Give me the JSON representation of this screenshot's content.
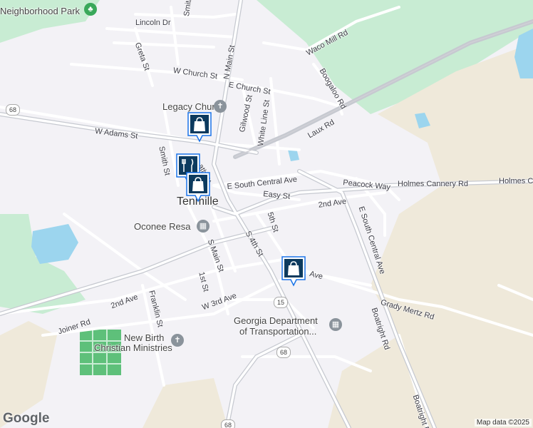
{
  "map": {
    "town": "Tenmille",
    "attribution": "Map data ©2025",
    "logo": "Google",
    "colors": {
      "background": "#f3f2f6",
      "park": "#c8ecd3",
      "sand": "#efe9da",
      "water": "#9cd5ee",
      "road": "#ffffff",
      "major_road": "#c6c9d0",
      "marker": "#0c3a5e"
    }
  },
  "labels": {
    "neighborhood_park": "Neighborhood Park",
    "lincoln_dr": "Lincoln Dr",
    "smith_st_top": "Smith",
    "greta_st": "Greta St",
    "n_main_st": "N Main St",
    "w_church_st": "W Church St",
    "e_church_st": "E Church St",
    "waco_mill_rd": "Waco Mill Rd",
    "boogaloo_rd": "Boogaloo Rd",
    "legacy_church": "Legacy Church",
    "gilwood_st": "Gilwood St",
    "white_line_st": "White Line St",
    "laux_rd": "Laux Rd",
    "w_adams_st": "W Adams St",
    "smith_st": "Smith St",
    "main_st_frag": "ath St",
    "e_south_central_ave": "E South Central Ave",
    "peacock_way": "Peacock Way",
    "holmes_cannery_rd": "Holmes Cannery Rd",
    "holmes_c": "Holmes C",
    "easy_st": "Easy St",
    "second_ave_e": "2nd Ave",
    "e_south_central_ave_vert": "E South Central Ave",
    "oconee_resa": "Oconee Resa",
    "fifth_st": "5th St",
    "s_main_st": "S Main St",
    "s_4th_st": "S 4th St",
    "first_st": "1st St",
    "ave_frag": "Ave",
    "grady_mertz_rd": "Grady Mertz Rd",
    "boatright_rd": "Boatright Rd",
    "boatright_rd_2": "Boatright R",
    "second_ave_w": "2nd Ave",
    "franklin_st": "Franklin St",
    "w_3rd_ave": "W 3rd Ave",
    "joiner_rd": "Joiner Rd",
    "gdot_line1": "Georgia Department",
    "gdot_line2": "of Transportation...",
    "new_birth_line1": "New Birth",
    "new_birth_line2": "Christian Ministries"
  },
  "shields": {
    "route_68_w": "68",
    "route_15": "15",
    "route_68_s": "68",
    "route_68_bottom": "68"
  },
  "icons": {
    "park": "tree-icon",
    "church": "cross-icon",
    "government": "building-icon",
    "shopping": "shopping-bag-icon",
    "restaurant": "fork-knife-icon"
  }
}
